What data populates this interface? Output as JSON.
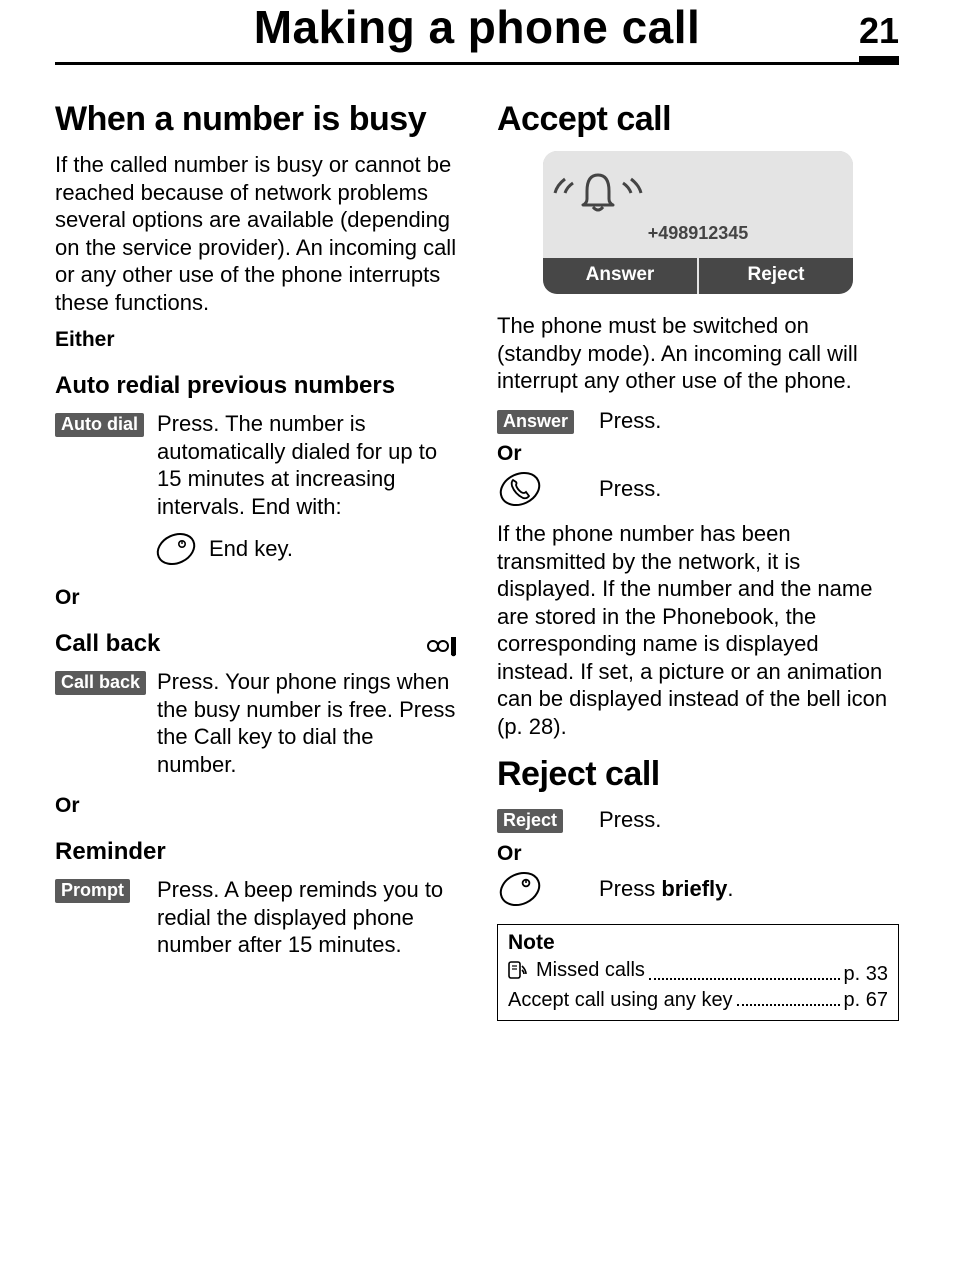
{
  "header": {
    "title": "Making a phone call",
    "page_number": "21"
  },
  "left": {
    "h_busy": "When a number is busy",
    "busy_intro": "If the called number is busy or cannot be reached because of network problems several options are available (depending on the service provider). An incoming call or any other use of the phone interrupts these functions.",
    "either_label": "Either",
    "auto_redial_heading": "Auto redial previous numbers",
    "auto_dial_btn": "Auto dial",
    "auto_dial_text": "Press. The number is automatically dialed for up to 15 minutes at increasing intervals. End with:",
    "end_key_label": "End key.",
    "or1": "Or",
    "callback_heading": "Call back",
    "callback_btn": "Call back",
    "callback_text": "Press. Your phone rings when the busy number is free. Press the Call key to dial the number.",
    "or2": "Or",
    "reminder_heading": "Reminder",
    "prompt_btn": "Prompt",
    "prompt_text": "Press. A beep reminds you to redial the displayed phone number after 15 minutes."
  },
  "right": {
    "h_accept": "Accept call",
    "screen_number": "+498912345",
    "screen_answer": "Answer",
    "screen_reject": "Reject",
    "accept_intro": "The phone must be switched on (standby mode). An incoming call will interrupt any other use of the phone.",
    "answer_btn": "Answer",
    "answer_press": "Press.",
    "or1": "Or",
    "call_key_press": "Press.",
    "accept_detail": "If the phone number has been transmitted by the network, it is displayed. If the number and the name are stored in the Phonebook, the corresponding name is displayed instead. If set, a picture or an animation can be displayed instead of the bell icon (p. 28).",
    "h_reject": "Reject call",
    "reject_btn": "Reject",
    "reject_press": "Press.",
    "or2": "Or",
    "end_press_pre": "Press ",
    "end_press_bold": "briefly",
    "end_press_post": ".",
    "note_title": "Note",
    "note_missed_label": "Missed calls",
    "note_missed_page": "p. 33",
    "note_anykey_label": "Accept call using any key",
    "note_anykey_page": "p. 67"
  }
}
